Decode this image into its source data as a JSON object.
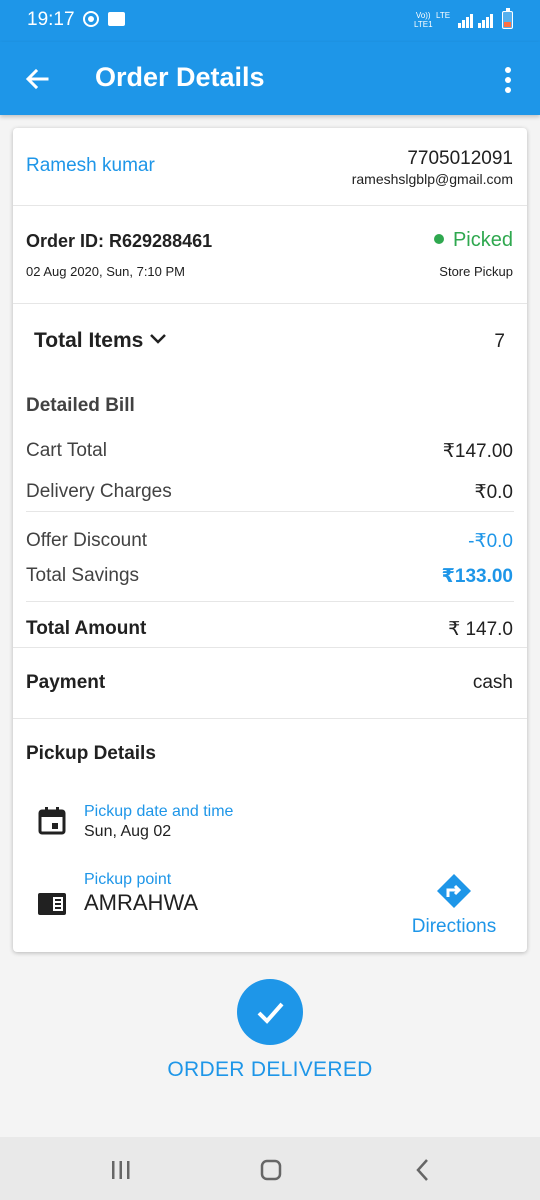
{
  "status_bar": {
    "time": "19:17",
    "net_top": "Vo)) LTE1",
    "net_lte": "LTE",
    "icons": [
      "sync-icon",
      "message-icon",
      "signal-icon",
      "battery-icon"
    ]
  },
  "app_bar": {
    "title": "Order Details",
    "back_icon": "arrow-back-icon",
    "menu_icon": "more-vert-icon"
  },
  "customer": {
    "name": "Ramesh kumar",
    "phone": "7705012091",
    "email": "rameshslgblp@gmail.com"
  },
  "order": {
    "id_label": "Order ID: R629288461",
    "date": "02 Aug 2020, Sun, 7:10 PM",
    "status": "Picked",
    "status_color": "#2fa84f",
    "type": "Store Pickup"
  },
  "items": {
    "label": "Total Items",
    "count": "7"
  },
  "bill": {
    "title": "Detailed Bill",
    "cart_total_label": "Cart Total",
    "cart_total_value": "₹147.00",
    "delivery_label": "Delivery Charges",
    "delivery_value": "₹0.0",
    "offer_label": "Offer Discount",
    "offer_value": "-₹0.0",
    "savings_label": "Total Savings",
    "savings_value": "₹133.00",
    "total_label": "Total Amount",
    "total_value": "₹ 147.0"
  },
  "payment": {
    "label": "Payment",
    "value": "cash"
  },
  "pickup": {
    "title": "Pickup Details",
    "datetime_label": "Pickup date and time",
    "datetime_value": "Sun, Aug 02",
    "point_label": "Pickup point",
    "point_value": "AMRAHWA",
    "directions_label": "Directions"
  },
  "action": {
    "label": "ORDER DELIVERED",
    "icon": "check-icon"
  },
  "nav": {
    "icons": [
      "recent-apps-icon",
      "home-icon",
      "back-icon"
    ]
  },
  "colors": {
    "primary": "#1e96e8",
    "success": "#2fa84f"
  }
}
